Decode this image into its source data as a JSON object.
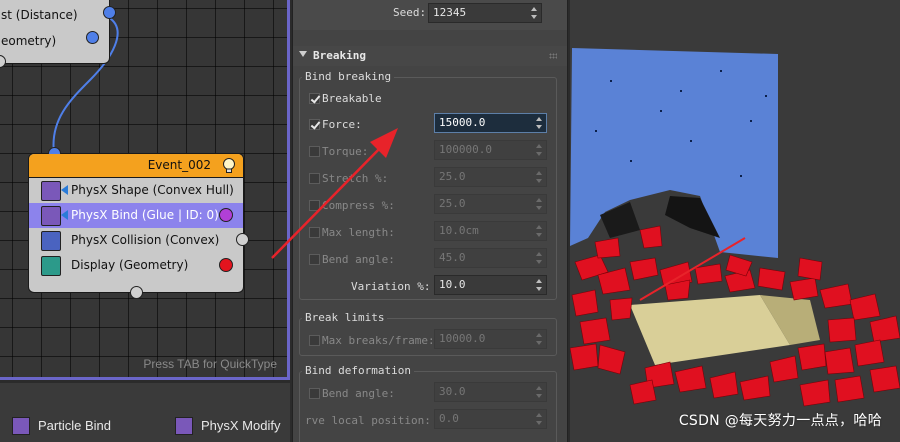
{
  "node_editor": {
    "top_node": {
      "row1": "st (Distance)",
      "row2": "eometry)"
    },
    "event_node": {
      "title": "Event_002",
      "operators": [
        {
          "label": "PhysX Shape (Convex Hull)",
          "icon": "physx-shape-icon"
        },
        {
          "label": "PhysX Bind (Glue | ID: 0)",
          "icon": "physx-bind-icon"
        },
        {
          "label": "PhysX Collision (Convex)",
          "icon": "physx-collision-icon"
        },
        {
          "label": "Display (Geometry)",
          "icon": "display-icon"
        }
      ]
    },
    "hint": "Press TAB for QuickType"
  },
  "depot": {
    "item1": "Particle Bind",
    "item2": "PhysX Modify"
  },
  "panel": {
    "seed_label": "Seed:",
    "seed_value": "12345",
    "rollout_title": "Breaking",
    "bind_breaking": {
      "title": "Bind breaking",
      "breakable_label": "Breakable",
      "force_label": "Force:",
      "force_value": "15000.0",
      "torque_label": "Torque:",
      "torque_value": "100000.0",
      "stretch_label": "Stretch %:",
      "stretch_value": "25.0",
      "compress_label": "Compress %:",
      "compress_value": "25.0",
      "max_length_label": "Max length:",
      "max_length_value": "10.0cm",
      "bend_angle_label": "Bend angle:",
      "bend_angle_value": "45.0",
      "variation_label": "Variation %:",
      "variation_value": "10.0"
    },
    "break_limits": {
      "title": "Break limits",
      "max_breaks_label": "Max breaks/frame:",
      "max_breaks_value": "10000.0"
    },
    "bind_deformation": {
      "title": "Bind deformation",
      "bend_angle_label": "Bend angle:",
      "bend_angle_value": "30.0",
      "local_pos_label": "rve local position:",
      "local_pos_value": "0.0"
    }
  },
  "watermark": "CSDN @每天努力一点点，哈哈",
  "colors": {
    "node_header": "#f4a11e",
    "selection": "#8c83ec",
    "wall": "#5a82d6",
    "debris": "#e01020",
    "box": "#d9cf98",
    "arrow": "#e8232a"
  }
}
